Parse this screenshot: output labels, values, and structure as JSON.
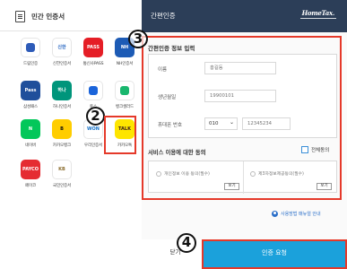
{
  "left_panel": {
    "title": "민간 인증서",
    "apps": [
      {
        "name": "app-dreamcert",
        "label": "드림인증",
        "tile_text": "",
        "bg": "#ffffff",
        "fg": "#2d5bb8"
      },
      {
        "name": "app-shinhan",
        "label": "신한인증서",
        "tile_text": "신한",
        "bg": "#ffffff",
        "fg": "#1e5fbf"
      },
      {
        "name": "app-pass",
        "label": "통신사PASS",
        "tile_text": "PASS",
        "bg": "#e51e26",
        "fg": "#ffffff"
      },
      {
        "name": "app-nh",
        "label": "NH인증서",
        "tile_text": "NH",
        "bg": "#1d5bb5",
        "fg": "#ffffff"
      },
      {
        "name": "app-samsungpass",
        "label": "삼성패스",
        "tile_text": "Pass",
        "bg": "#1f4f9b",
        "fg": "#ffffff"
      },
      {
        "name": "app-hana",
        "label": "하나인증서",
        "tile_text": "하나",
        "bg": "#00957b",
        "fg": "#ffffff"
      },
      {
        "name": "app-toss",
        "label": "토스",
        "tile_text": "",
        "bg": "#ffffff",
        "fg": "#1b64da"
      },
      {
        "name": "app-bankshield",
        "label": "뱅크샐러드",
        "tile_text": "",
        "bg": "#ffffff",
        "fg": "#19b76e"
      },
      {
        "name": "app-naver",
        "label": "네이버",
        "tile_text": "N",
        "bg": "#03c75a",
        "fg": "#ffffff"
      },
      {
        "name": "app-kbank",
        "label": "카카오뱅크",
        "tile_text": "B",
        "bg": "#ffcd00",
        "fg": "#111111"
      },
      {
        "name": "app-woori",
        "label": "우리인증서",
        "tile_text": "WON",
        "bg": "#ffffff",
        "fg": "#1570c6"
      },
      {
        "name": "app-kakaotalk",
        "label": "카카오톡",
        "tile_text": "TALK",
        "bg": "#fee500",
        "fg": "#3a1d1d"
      },
      {
        "name": "app-payco",
        "label": "페이코",
        "tile_text": "PAYCO",
        "bg": "#e52c32",
        "fg": "#ffffff"
      },
      {
        "name": "app-kb",
        "label": "국민인증서",
        "tile_text": "KB",
        "bg": "#ffffff",
        "fg": "#8b6d2e"
      }
    ]
  },
  "right_panel": {
    "header_title": "간편인증",
    "logo_text": "HomeTax.",
    "section_title": "간편인증 정보 입력",
    "form": {
      "name_label": "이름",
      "name_placeholder": "홍길동",
      "birth_label": "생년월일",
      "birth_placeholder": "19900101",
      "phone_label": "휴대폰 번호",
      "carrier_value": "010",
      "phone_placeholder": "12345234"
    },
    "service_title": "서비스 이용에 대한 동의",
    "all_agree_label": "전체동의",
    "consent": {
      "privacy_label": "개인정보 이용 동의(필수)",
      "third_party_label": "제3자정보제공동의(필수)",
      "view_label": "보기"
    },
    "help_text": "사용방법 매뉴얼 안내",
    "close_label": "닫기",
    "request_label": "인증 요청"
  },
  "annotations": {
    "step2": "2",
    "step3": "3",
    "step4": "4",
    "accent_color": "#e5392a"
  },
  "colors": {
    "header_bg": "#2c3e58",
    "primary_button": "#1ba1db",
    "link": "#2a6fc9"
  }
}
